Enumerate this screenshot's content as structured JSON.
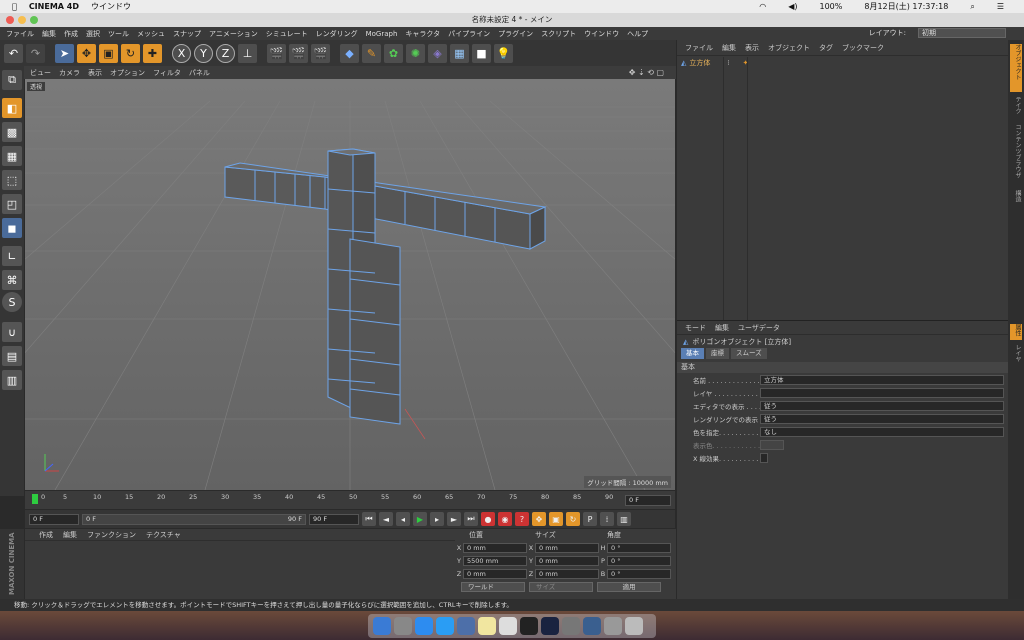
{
  "mac": {
    "apple": "",
    "app": "CINEMA 4D",
    "menu1": "ウインドウ",
    "battery": "100%",
    "datetime": "8月12日(土)  17:37:18"
  },
  "window": {
    "title": "名称未設定 4 * - メイン"
  },
  "menubar": {
    "items": [
      "ファイル",
      "編集",
      "作成",
      "選択",
      "ツール",
      "メッシュ",
      "スナップ",
      "アニメーション",
      "シミュレート",
      "レンダリング",
      "MoGraph",
      "キャラクタ",
      "パイプライン",
      "プラグイン",
      "スクリプト",
      "ウインドウ",
      "ヘルプ"
    ],
    "layout_label": "レイアウト:",
    "layout_value": "初期"
  },
  "viewport": {
    "menu": [
      "ビュー",
      "カメラ",
      "表示",
      "オプション",
      "フィルタ",
      "パネル"
    ],
    "camera_label": "透視",
    "grid_info": "グリッド間隔 : 10000 mm"
  },
  "timeline": {
    "ticks": [
      "0",
      "5",
      "10",
      "15",
      "20",
      "25",
      "30",
      "35",
      "40",
      "45",
      "50",
      "55",
      "60",
      "65",
      "70",
      "75",
      "80",
      "85",
      "90"
    ],
    "end_field": "0 F"
  },
  "transport": {
    "start": "0 F",
    "range_start": "0 F",
    "range_end": "90 F",
    "end": "90 F"
  },
  "material": {
    "menu": [
      "作成",
      "編集",
      "ファンクション",
      "テクスチャ"
    ],
    "brand": "MAXON CINEMA 4D"
  },
  "coords": {
    "head_pos": "位置",
    "head_size": "サイズ",
    "head_rot": "角度",
    "rows": [
      {
        "a": "X",
        "pos": "0 mm",
        "b": "X",
        "size": "0 mm",
        "c": "H",
        "rot": "0 °"
      },
      {
        "a": "Y",
        "pos": "5500 mm",
        "b": "Y",
        "size": "0 mm",
        "c": "P",
        "rot": "0 °"
      },
      {
        "a": "Z",
        "pos": "0 mm",
        "b": "Z",
        "size": "0 mm",
        "c": "B",
        "rot": "0 °"
      }
    ],
    "world": "ワールド",
    "size_mode": "サイズ",
    "apply": "適用"
  },
  "status": "移動: クリック＆ドラッグでエレメントを移動させます。ポイントモードでSHIFTキーを押さえて押し出し量の量子化ならびに選択範囲を追加し、CTRLキーで削除します。",
  "objects": {
    "menu": [
      "ファイル",
      "編集",
      "表示",
      "オブジェクト",
      "タグ",
      "ブックマーク"
    ],
    "item": "立方体"
  },
  "attributes": {
    "menu": [
      "モード",
      "編集",
      "ユーザデータ"
    ],
    "title": "ポリゴンオブジェクト [立方体]",
    "tabs": [
      "基本",
      "座標",
      "スムーズ"
    ],
    "section": "基本",
    "rows": [
      {
        "label": "名前 . . . . . . . . . . . . . . .",
        "value": "立方体"
      },
      {
        "label": "レイヤ . . . . . . . . . . . . . .",
        "value": ""
      },
      {
        "label": "エディタでの表示 . . . . .",
        "value": "従う"
      },
      {
        "label": "レンダリングでの表示 .",
        "value": "従う"
      },
      {
        "label": "色を指定. . . . . . . . . . .",
        "value": "なし"
      },
      {
        "label": "表示色. . . . . . . . . . . .",
        "value": ""
      },
      {
        "label": "X 線効果. . . . . . . . . . .",
        "value": ""
      }
    ]
  },
  "right_tabs": [
    "オブジェクト",
    "テイク",
    "コンテンツブラウザ",
    "構造"
  ],
  "right_tabs2": [
    "属性",
    "レイヤ"
  ]
}
